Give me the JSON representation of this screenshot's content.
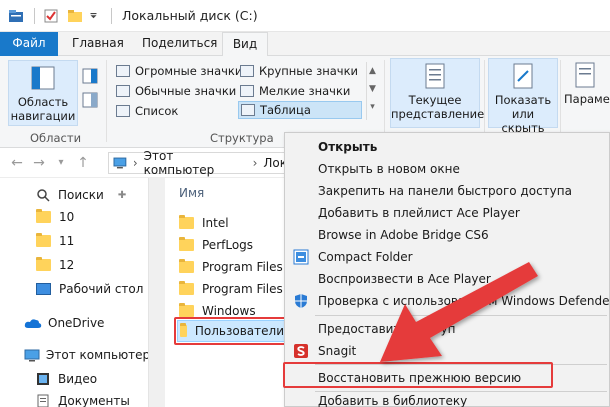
{
  "window": {
    "title": "Локальный диск (C:)"
  },
  "ribbon_tabs": [
    "Файл",
    "Главная",
    "Поделиться",
    "Вид"
  ],
  "ribbon": {
    "panes": {
      "button": "Область навигации",
      "button_l1": "Область",
      "button_l2": "навигации",
      "group": "Области"
    },
    "layout": {
      "items": [
        "Огромные значки",
        "Крупные значки",
        "Обычные значки",
        "Мелкие значки",
        "Список",
        "Таблица"
      ],
      "group": "Структура",
      "selected": "Таблица"
    },
    "current_view": {
      "l1": "Текущее",
      "l2": "представление"
    },
    "show_hide": {
      "l1": "Показать",
      "l2": "или скрыть"
    },
    "options": {
      "l1": "Парамет"
    }
  },
  "address": {
    "path": [
      "Этот компьютер",
      "Лок"
    ]
  },
  "nav_pane": {
    "items": [
      "Поиски",
      "10",
      "11",
      "12",
      "Рабочий стол",
      "OneDrive",
      "Этот компьютер",
      "Видео",
      "Документы"
    ]
  },
  "content": {
    "column_header": "Имя",
    "files": [
      "Intel",
      "PerfLogs",
      "Program Files",
      "Program Files (x",
      "Windows",
      "Пользователи"
    ],
    "selected": "Пользователи"
  },
  "context_menu": {
    "items": [
      "Открыть",
      "Открыть в новом окне",
      "Закрепить на панели быстрого доступа",
      "Добавить в плейлист Ace Player",
      "Browse in Adobe Bridge CS6",
      "Compact Folder",
      "Воспроизвести в Ace Player",
      "Проверка с использованием Windows Defender...",
      "Предоставить доступ",
      "Snagit",
      "Восстановить прежнюю версию",
      "Добавить в библиотеку"
    ],
    "highlighted": "Восстановить прежнюю версию"
  },
  "colors": {
    "accent": "#1979ca",
    "highlight_red": "#e53b3b",
    "selection": "#cce8ff"
  }
}
